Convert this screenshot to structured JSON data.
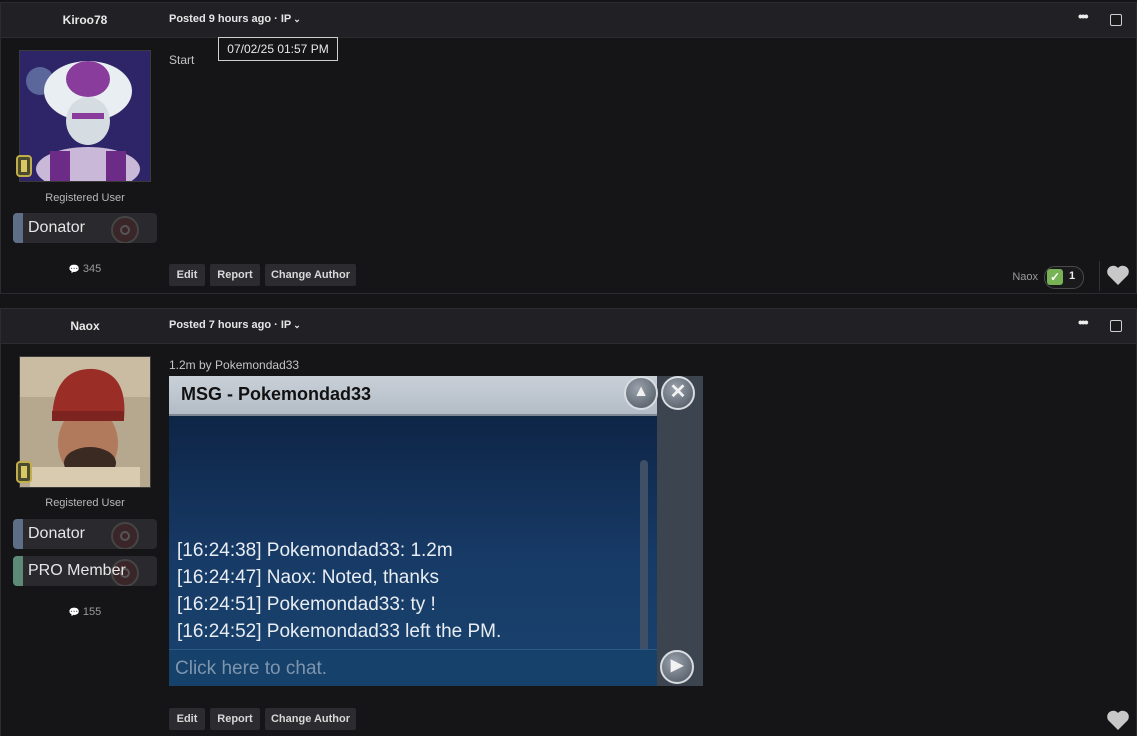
{
  "posts": [
    {
      "author": "Kiroo78",
      "posted": "Posted 9 hours ago · IP",
      "tooltip": "07/02/25 01:57  PM",
      "user_title": "Registered User",
      "groups": [
        "Donator"
      ],
      "post_count": "345",
      "content": "Start",
      "actions": [
        "Edit",
        "Report",
        "Change Author"
      ],
      "reaction": {
        "user": "Naox",
        "count": "1",
        "icon": "check-mark"
      }
    },
    {
      "author": "Naox",
      "posted": "Posted 7 hours ago · IP",
      "user_title": "Registered User",
      "groups": [
        "Donator",
        "PRO Member"
      ],
      "post_count": "155",
      "content": "1.2m by Pokemondad33",
      "actions": [
        "Edit",
        "Report",
        "Change Author"
      ],
      "embedded_window": {
        "title": "MSG - Pokemondad33",
        "messages": [
          "[16:24:38] Pokemondad33: 1.2m",
          "[16:24:47] Naox: Noted, thanks",
          "[16:24:51] Pokemondad33: ty !",
          "[16:24:52] Pokemondad33 left the PM."
        ],
        "input_placeholder": "Click here to chat."
      }
    }
  ],
  "colors": {
    "background": "#151517",
    "header": "#212125",
    "button": "#2c2c30",
    "reaction_check": "#77b255"
  }
}
